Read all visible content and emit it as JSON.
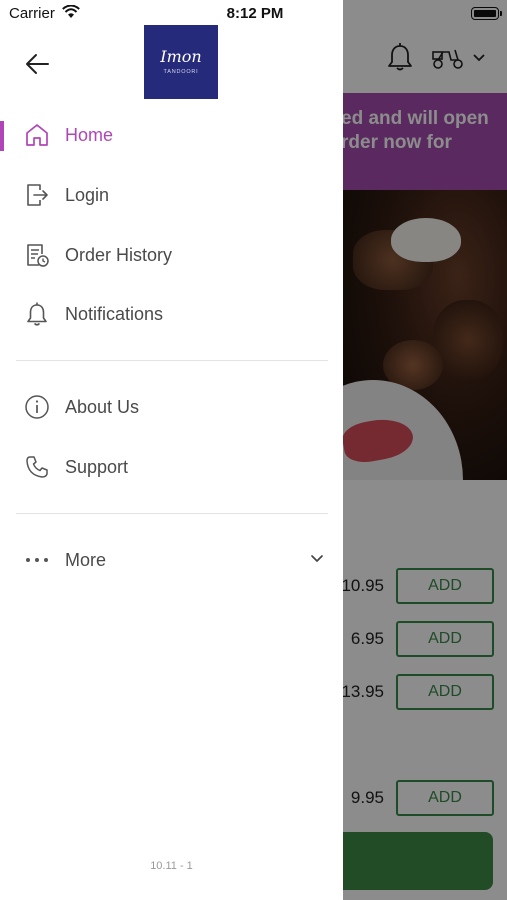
{
  "status_bar": {
    "carrier": "Carrier",
    "time": "8:12 PM"
  },
  "brand": {
    "logo_text": "Imon",
    "logo_subtext": "TANDOORI",
    "logo_color": "#262a7a"
  },
  "accent_color": "#b045b8",
  "menu": {
    "items": [
      {
        "label": "Home",
        "icon": "home-icon",
        "active": true
      },
      {
        "label": "Login",
        "icon": "login-icon"
      },
      {
        "label": "Order History",
        "icon": "order-history-icon"
      },
      {
        "label": "Notifications",
        "icon": "bell-icon"
      },
      {
        "label": "About Us",
        "icon": "info-icon"
      },
      {
        "label": "Support",
        "icon": "phone-icon"
      },
      {
        "label": "More",
        "icon": "more-dots-icon"
      }
    ]
  },
  "version": "10.11 - 1",
  "background": {
    "banner_text": "ed and will open\nrder now for",
    "prices": [
      "10.95",
      "6.95",
      "13.95",
      "9.95"
    ],
    "add_label": "ADD",
    "banner_color": "#a24cae",
    "add_color": "#3a8a4a"
  }
}
